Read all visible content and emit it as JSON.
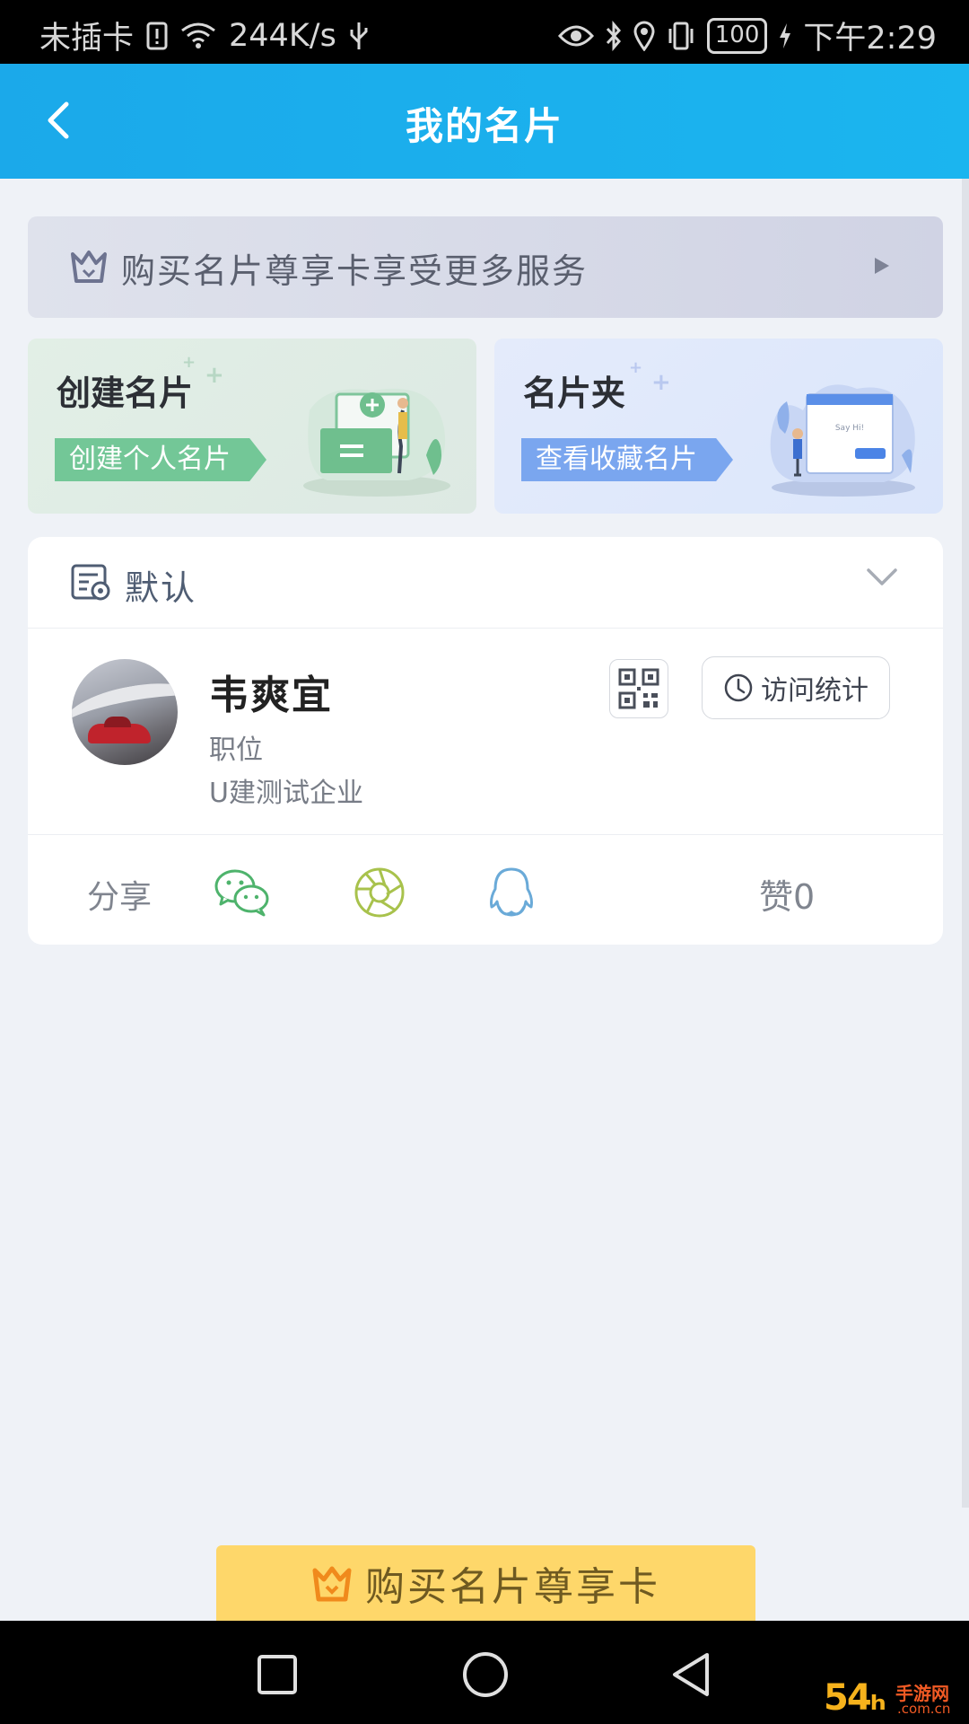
{
  "status_bar": {
    "carrier": "未插卡",
    "speed": "244K/s",
    "battery": "100",
    "time": "下午2:29"
  },
  "header": {
    "title": "我的名片",
    "back_icon": "chevron-left-icon"
  },
  "vip_banner": {
    "text": "购买名片尊享卡享受更多服务",
    "icon": "crown-icon"
  },
  "feature_cards": [
    {
      "title": "创建名片",
      "button": "创建个人名片",
      "color": "#73c797"
    },
    {
      "title": "名片夹",
      "button": "查看收藏名片",
      "color": "#7aa6ef"
    }
  ],
  "card_panel": {
    "group_label": "默认",
    "profile": {
      "name": "韦爽宜",
      "title": "职位",
      "company": "U建测试企业"
    },
    "stats_button": "访问统计",
    "share_label": "分享",
    "share_targets": [
      "wechat-icon",
      "moments-icon",
      "qq-icon"
    ],
    "likes": "赞0"
  },
  "buy_button": {
    "label": "购买名片尊享卡",
    "color": "#fed76a"
  },
  "watermark": {
    "num": "54ₕ",
    "text": "手游网",
    "sub": ".com.cn"
  }
}
